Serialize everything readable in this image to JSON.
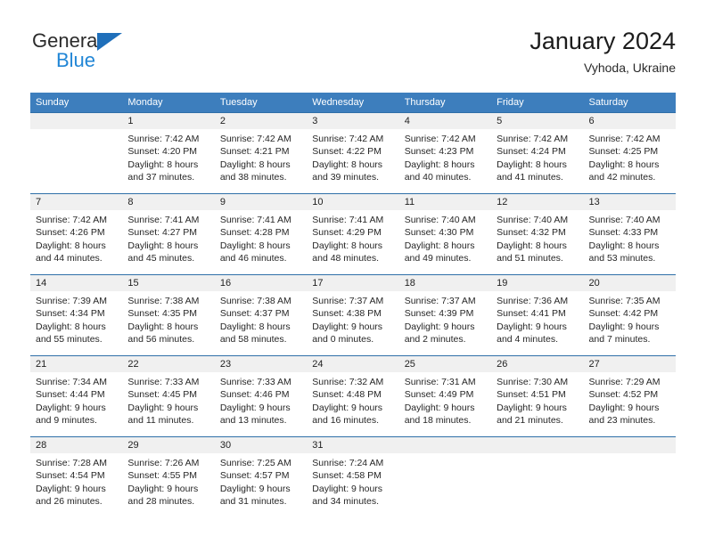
{
  "brand": {
    "name_top": "General",
    "name_bottom": "Blue",
    "triangle_color": "#1f6fba",
    "blue_text_color": "#2186d6"
  },
  "header": {
    "title": "January 2024",
    "subtitle": "Vyhoda, Ukraine"
  },
  "colors": {
    "header_band": "#3d7ebd",
    "date_band": "#f0f0f0",
    "week_separator": "#2f6fa8",
    "body_text": "#262626"
  },
  "weekdays": [
    "Sunday",
    "Monday",
    "Tuesday",
    "Wednesday",
    "Thursday",
    "Friday",
    "Saturday"
  ],
  "weeks": [
    {
      "dates": [
        "",
        "1",
        "2",
        "3",
        "4",
        "5",
        "6"
      ],
      "cells": [
        {
          "lines": []
        },
        {
          "lines": [
            "Sunrise: 7:42 AM",
            "Sunset: 4:20 PM",
            "Daylight: 8 hours",
            "and 37 minutes."
          ]
        },
        {
          "lines": [
            "Sunrise: 7:42 AM",
            "Sunset: 4:21 PM",
            "Daylight: 8 hours",
            "and 38 minutes."
          ]
        },
        {
          "lines": [
            "Sunrise: 7:42 AM",
            "Sunset: 4:22 PM",
            "Daylight: 8 hours",
            "and 39 minutes."
          ]
        },
        {
          "lines": [
            "Sunrise: 7:42 AM",
            "Sunset: 4:23 PM",
            "Daylight: 8 hours",
            "and 40 minutes."
          ]
        },
        {
          "lines": [
            "Sunrise: 7:42 AM",
            "Sunset: 4:24 PM",
            "Daylight: 8 hours",
            "and 41 minutes."
          ]
        },
        {
          "lines": [
            "Sunrise: 7:42 AM",
            "Sunset: 4:25 PM",
            "Daylight: 8 hours",
            "and 42 minutes."
          ]
        }
      ]
    },
    {
      "dates": [
        "7",
        "8",
        "9",
        "10",
        "11",
        "12",
        "13"
      ],
      "cells": [
        {
          "lines": [
            "Sunrise: 7:42 AM",
            "Sunset: 4:26 PM",
            "Daylight: 8 hours",
            "and 44 minutes."
          ]
        },
        {
          "lines": [
            "Sunrise: 7:41 AM",
            "Sunset: 4:27 PM",
            "Daylight: 8 hours",
            "and 45 minutes."
          ]
        },
        {
          "lines": [
            "Sunrise: 7:41 AM",
            "Sunset: 4:28 PM",
            "Daylight: 8 hours",
            "and 46 minutes."
          ]
        },
        {
          "lines": [
            "Sunrise: 7:41 AM",
            "Sunset: 4:29 PM",
            "Daylight: 8 hours",
            "and 48 minutes."
          ]
        },
        {
          "lines": [
            "Sunrise: 7:40 AM",
            "Sunset: 4:30 PM",
            "Daylight: 8 hours",
            "and 49 minutes."
          ]
        },
        {
          "lines": [
            "Sunrise: 7:40 AM",
            "Sunset: 4:32 PM",
            "Daylight: 8 hours",
            "and 51 minutes."
          ]
        },
        {
          "lines": [
            "Sunrise: 7:40 AM",
            "Sunset: 4:33 PM",
            "Daylight: 8 hours",
            "and 53 minutes."
          ]
        }
      ]
    },
    {
      "dates": [
        "14",
        "15",
        "16",
        "17",
        "18",
        "19",
        "20"
      ],
      "cells": [
        {
          "lines": [
            "Sunrise: 7:39 AM",
            "Sunset: 4:34 PM",
            "Daylight: 8 hours",
            "and 55 minutes."
          ]
        },
        {
          "lines": [
            "Sunrise: 7:38 AM",
            "Sunset: 4:35 PM",
            "Daylight: 8 hours",
            "and 56 minutes."
          ]
        },
        {
          "lines": [
            "Sunrise: 7:38 AM",
            "Sunset: 4:37 PM",
            "Daylight: 8 hours",
            "and 58 minutes."
          ]
        },
        {
          "lines": [
            "Sunrise: 7:37 AM",
            "Sunset: 4:38 PM",
            "Daylight: 9 hours",
            "and 0 minutes."
          ]
        },
        {
          "lines": [
            "Sunrise: 7:37 AM",
            "Sunset: 4:39 PM",
            "Daylight: 9 hours",
            "and 2 minutes."
          ]
        },
        {
          "lines": [
            "Sunrise: 7:36 AM",
            "Sunset: 4:41 PM",
            "Daylight: 9 hours",
            "and 4 minutes."
          ]
        },
        {
          "lines": [
            "Sunrise: 7:35 AM",
            "Sunset: 4:42 PM",
            "Daylight: 9 hours",
            "and 7 minutes."
          ]
        }
      ]
    },
    {
      "dates": [
        "21",
        "22",
        "23",
        "24",
        "25",
        "26",
        "27"
      ],
      "cells": [
        {
          "lines": [
            "Sunrise: 7:34 AM",
            "Sunset: 4:44 PM",
            "Daylight: 9 hours",
            "and 9 minutes."
          ]
        },
        {
          "lines": [
            "Sunrise: 7:33 AM",
            "Sunset: 4:45 PM",
            "Daylight: 9 hours",
            "and 11 minutes."
          ]
        },
        {
          "lines": [
            "Sunrise: 7:33 AM",
            "Sunset: 4:46 PM",
            "Daylight: 9 hours",
            "and 13 minutes."
          ]
        },
        {
          "lines": [
            "Sunrise: 7:32 AM",
            "Sunset: 4:48 PM",
            "Daylight: 9 hours",
            "and 16 minutes."
          ]
        },
        {
          "lines": [
            "Sunrise: 7:31 AM",
            "Sunset: 4:49 PM",
            "Daylight: 9 hours",
            "and 18 minutes."
          ]
        },
        {
          "lines": [
            "Sunrise: 7:30 AM",
            "Sunset: 4:51 PM",
            "Daylight: 9 hours",
            "and 21 minutes."
          ]
        },
        {
          "lines": [
            "Sunrise: 7:29 AM",
            "Sunset: 4:52 PM",
            "Daylight: 9 hours",
            "and 23 minutes."
          ]
        }
      ]
    },
    {
      "dates": [
        "28",
        "29",
        "30",
        "31",
        "",
        "",
        ""
      ],
      "cells": [
        {
          "lines": [
            "Sunrise: 7:28 AM",
            "Sunset: 4:54 PM",
            "Daylight: 9 hours",
            "and 26 minutes."
          ]
        },
        {
          "lines": [
            "Sunrise: 7:26 AM",
            "Sunset: 4:55 PM",
            "Daylight: 9 hours",
            "and 28 minutes."
          ]
        },
        {
          "lines": [
            "Sunrise: 7:25 AM",
            "Sunset: 4:57 PM",
            "Daylight: 9 hours",
            "and 31 minutes."
          ]
        },
        {
          "lines": [
            "Sunrise: 7:24 AM",
            "Sunset: 4:58 PM",
            "Daylight: 9 hours",
            "and 34 minutes."
          ]
        },
        {
          "lines": []
        },
        {
          "lines": []
        },
        {
          "lines": []
        }
      ]
    }
  ]
}
